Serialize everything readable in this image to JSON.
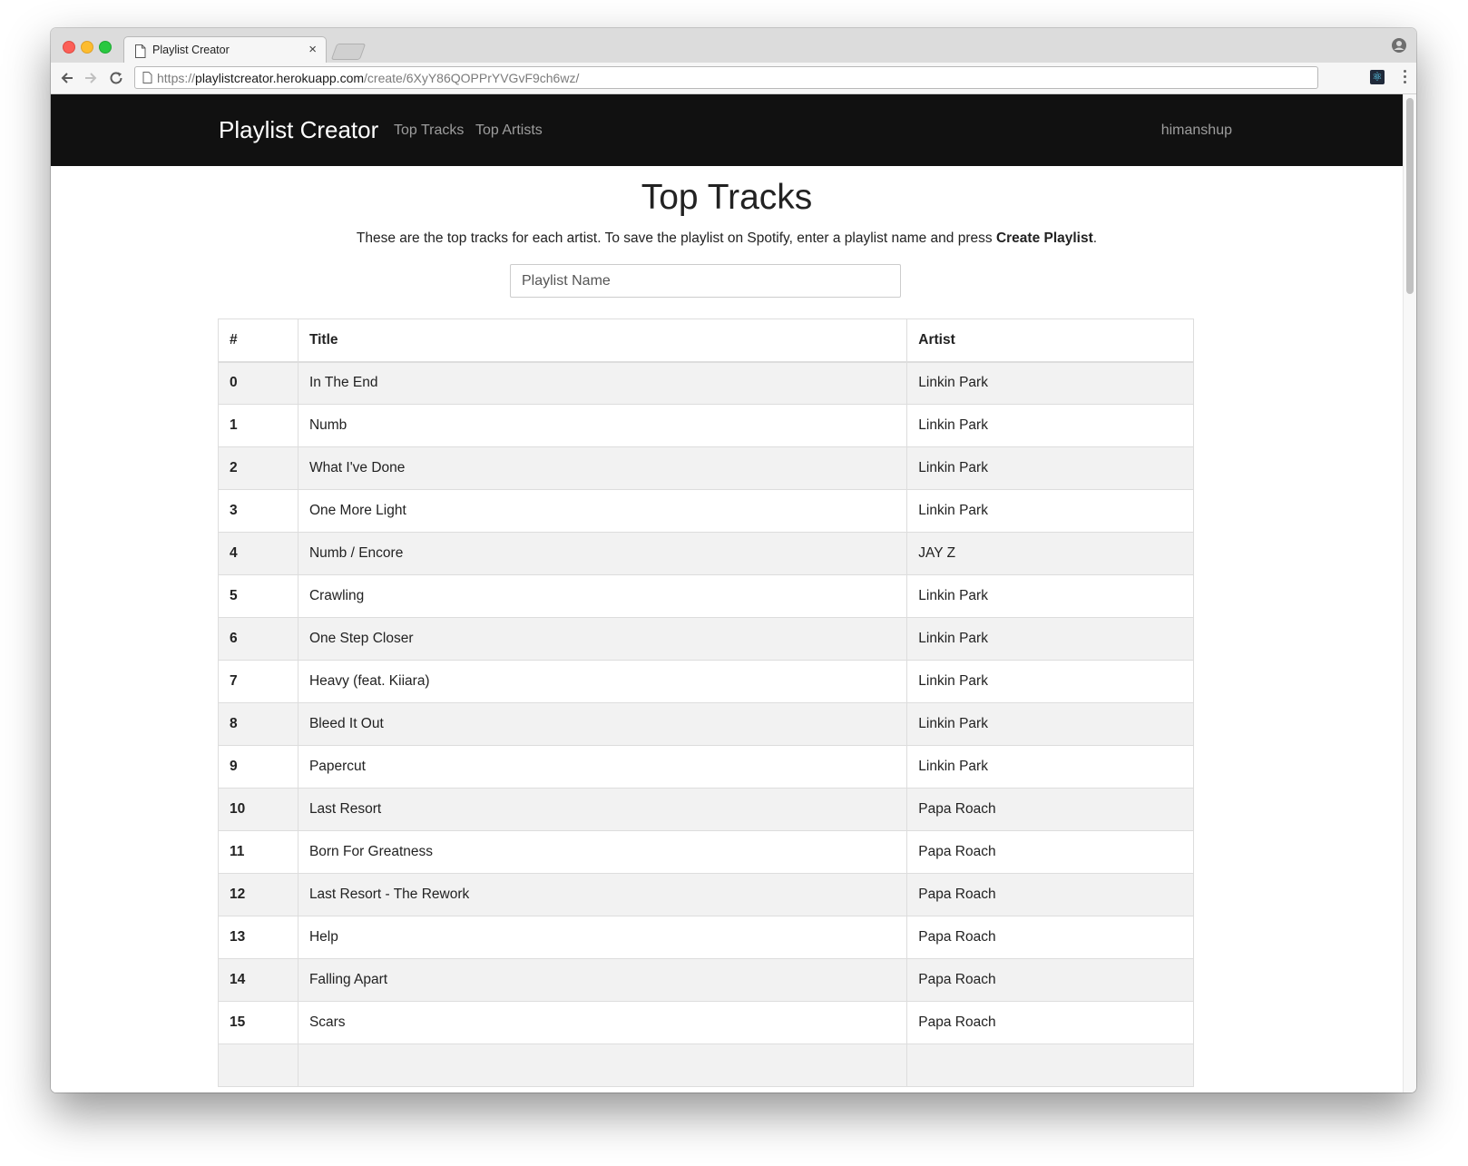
{
  "browser": {
    "tab_title": "Playlist Creator",
    "tab_close": "×",
    "url_scheme": "https://",
    "url_host": "playlistcreator.herokuapp.com",
    "url_path": "/create/6XyY86QOPPrYVGvF9ch6wz/",
    "extension_icon": "⚛"
  },
  "navbar": {
    "brand": "Playlist Creator",
    "links": [
      "Top Tracks",
      "Top Artists"
    ],
    "user": "himanshup"
  },
  "page": {
    "title": "Top Tracks",
    "intro_prefix": "These are the top tracks for each artist. To save the playlist on Spotify, enter a playlist name and press ",
    "intro_strong": "Create Playlist",
    "intro_suffix": ".",
    "playlist_placeholder": "Playlist Name"
  },
  "table": {
    "headers": [
      "#",
      "Title",
      "Artist"
    ],
    "rows": [
      [
        "0",
        "In The End",
        "Linkin Park"
      ],
      [
        "1",
        "Numb",
        "Linkin Park"
      ],
      [
        "2",
        "What I've Done",
        "Linkin Park"
      ],
      [
        "3",
        "One More Light",
        "Linkin Park"
      ],
      [
        "4",
        "Numb / Encore",
        "JAY Z"
      ],
      [
        "5",
        "Crawling",
        "Linkin Park"
      ],
      [
        "6",
        "One Step Closer",
        "Linkin Park"
      ],
      [
        "7",
        "Heavy (feat. Kiiara)",
        "Linkin Park"
      ],
      [
        "8",
        "Bleed It Out",
        "Linkin Park"
      ],
      [
        "9",
        "Papercut",
        "Linkin Park"
      ],
      [
        "10",
        "Last Resort",
        "Papa Roach"
      ],
      [
        "11",
        "Born For Greatness",
        "Papa Roach"
      ],
      [
        "12",
        "Last Resort - The Rework",
        "Papa Roach"
      ],
      [
        "13",
        "Help",
        "Papa Roach"
      ],
      [
        "14",
        "Falling Apart",
        "Papa Roach"
      ],
      [
        "15",
        "Scars",
        "Papa Roach"
      ],
      [
        "",
        "",
        ""
      ]
    ]
  }
}
